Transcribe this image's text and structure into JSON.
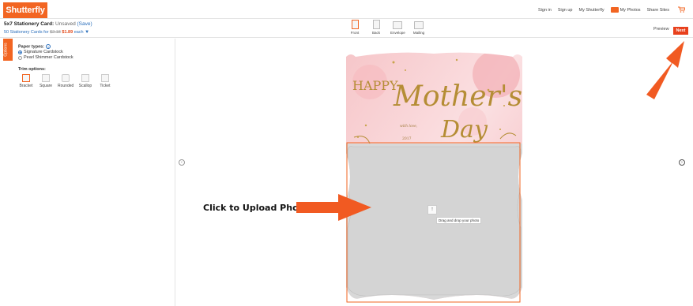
{
  "header": {
    "logo": "Shutterfly",
    "links": [
      "Sign in",
      "Sign up",
      "My Shutterfly",
      "My Photos",
      "Share Sites"
    ]
  },
  "product": {
    "title": "5x7 Stationery Card:",
    "status": "Unsaved",
    "save_label": "(Save)",
    "quantity_text": "50 Stationery Cards for",
    "old_price": "$2.18",
    "new_price": "$1.89",
    "each": "each",
    "caret": "▼"
  },
  "views": [
    "Front",
    "Back",
    "Envelope",
    "Mailing"
  ],
  "actions": {
    "preview": "Preview",
    "next": "Next"
  },
  "sidebar": {
    "tab_label": "Options",
    "paper_title": "Paper types:",
    "info": "i",
    "paper_options": [
      "Signature Cardstock",
      "Pearl Shimmer Cardstock"
    ],
    "trim_title": "Trim options:",
    "trim_options": [
      "Bracket",
      "Square",
      "Rounded",
      "Scallop",
      "Ticket"
    ]
  },
  "card": {
    "happy": "HAPPY",
    "mothers": "Mother's",
    "day": "Day",
    "signoff": "with love,",
    "year": "2017",
    "drop_hint": "Drag and drop your photo",
    "upload_icon": "↑"
  },
  "annotation": {
    "upload_label": "Click to Upload Photo"
  },
  "colors": {
    "brand": "#f26522",
    "next": "#e8401c",
    "link": "#2a6ebb",
    "arrow": "#f15a22"
  }
}
